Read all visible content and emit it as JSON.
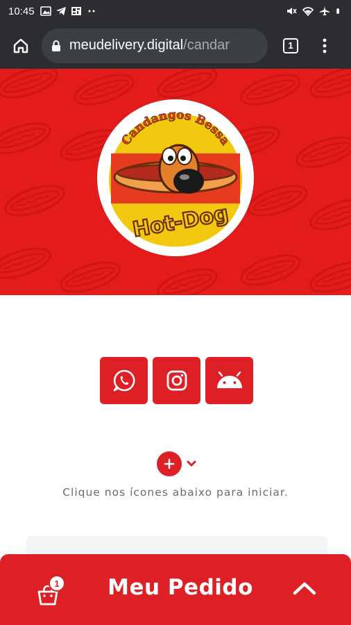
{
  "status_bar": {
    "time": "10:45",
    "left_icons": [
      "image-icon",
      "telegram-icon",
      "qr-icon",
      "more-dots-icon"
    ],
    "right_icons": [
      "mute-icon",
      "wifi-icon",
      "airplane-icon",
      "battery-icon"
    ]
  },
  "browser": {
    "url_domain": "meudelivery.digital",
    "url_path": "/candar",
    "tab_count": "1"
  },
  "logo": {
    "top_text": "Candangos Bessa",
    "main_text": "Hot-Dog"
  },
  "social": [
    {
      "name": "whatsapp"
    },
    {
      "name": "instagram"
    },
    {
      "name": "android"
    }
  ],
  "hint_text": "Clique nos ícones abaixo para iniciar.",
  "order_bar": {
    "title": "Meu Pedido",
    "cart_count": "1"
  },
  "colors": {
    "brand_red": "#dd1f26",
    "hero_red": "#e31b1b",
    "chrome_dark": "#2b2d31"
  }
}
